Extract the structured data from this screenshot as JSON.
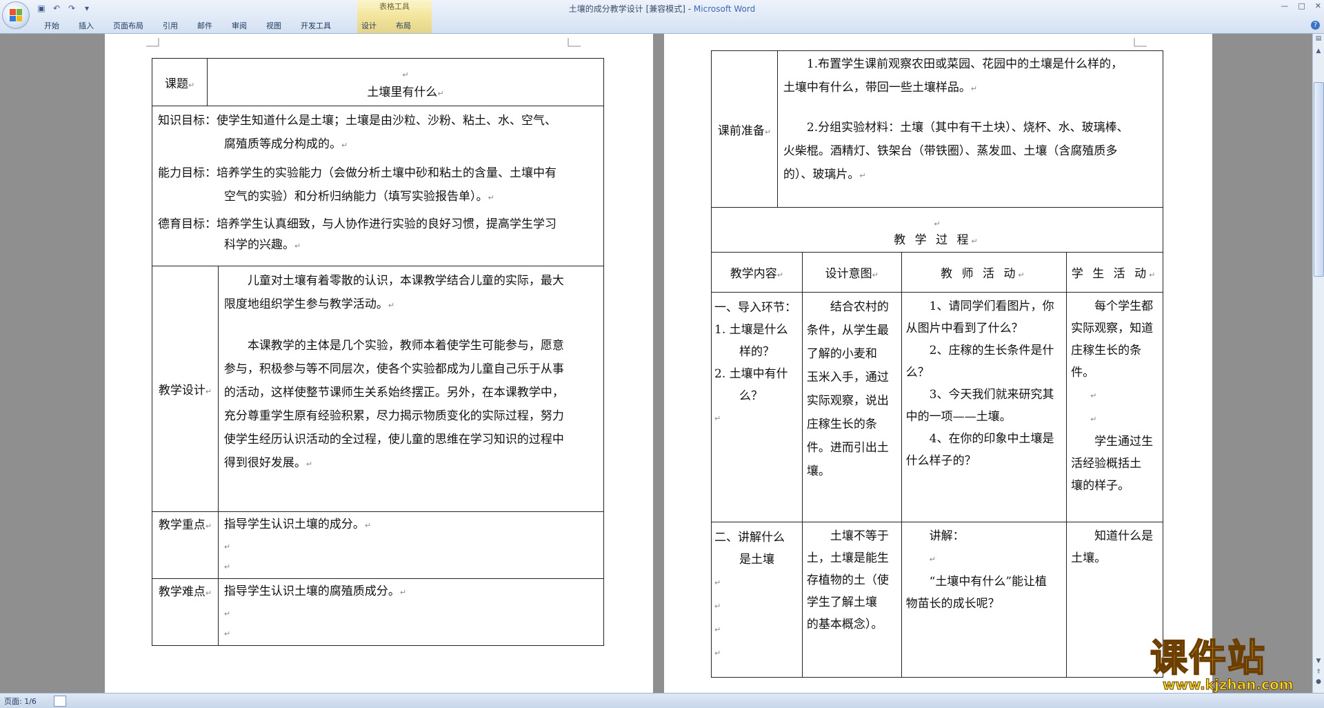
{
  "window": {
    "doc_title": "土壤的成分教学设计 [兼容模式] - ",
    "app_name": "Microsoft Word",
    "context_tools_label": "表格工具"
  },
  "ribbon": {
    "tabs": [
      "开始",
      "插入",
      "页面布局",
      "引用",
      "邮件",
      "审阅",
      "视图",
      "开发工具",
      "设计",
      "布局"
    ]
  },
  "status_bar": {
    "page": "页面: 1/6"
  },
  "page1": {
    "topic_label": "课题",
    "topic_value": "土壤里有什么",
    "objectives": [
      {
        "label": "知识目标：",
        "text": "使学生知道什么是土壤；土壤是由沙粒、沙粉、粘土、水、空气、",
        "cont": "腐殖质等成分构成的。"
      },
      {
        "label": "能力目标：",
        "text": "培养学生的实验能力（会做分析土壤中砂和粘土的含量、土壤中有",
        "cont": "空气的实验）和分析归纳能力（填写实验报告单）。"
      },
      {
        "label": "德育目标：",
        "text": "培养学生认真细致，与人协作进行实验的良好习惯，提高学生学习",
        "cont": "科学的兴趣。"
      }
    ],
    "design_label": "教学设计",
    "design_p1_l1": "儿童对土壤有着零散的认识，本课教学结合儿童的实际，最大",
    "design_p1_l2": "限度地组织学生参与教学活动。",
    "design_p2_lines": [
      "本课教学的主体是几个实验，教师本着使学生可能参与，愿意",
      "参与，积极参与等不同层次，使各个实验都成为儿童自己乐于从事",
      "的活动，这样使整节课师生关系始终摆正。另外，在本课教学中，",
      "充分尊重学生原有经验积累，尽力揭示物质变化的实际过程，努力",
      "使学生经历认识活动的全过程，使儿童的思维在学习知识的过程中",
      "得到很好发展。"
    ],
    "key_label": "教学重点",
    "key_text": "指导学生认识土壤的成分。",
    "difficulty_label": "教学难点",
    "difficulty_text": "指导学生认识土壤的腐殖质成分。"
  },
  "page2": {
    "prep_label": "课前准备",
    "prep_lines": [
      "1.布置学生课前观察农田或菜园、花园中的土壤是什么样的，",
      "土壤中有什么，带回一些土壤样品。",
      "2.分组实验材料：土壤（其中有干土块）、烧杯、水、玻璃棒、",
      "火柴棍。酒精灯、铁架台（带铁圈）、蒸发皿、土壤（含腐殖质多",
      "的）、玻璃片。"
    ],
    "process_title": "教 学 过 程",
    "headers": [
      "教学内容",
      "设计意图",
      "教 师 活 动",
      "学 生 活 动"
    ],
    "rows": [
      {
        "content": [
          "一、导入环节：",
          "1. 土壤是什么",
          "样的？",
          "2. 土壤中有什",
          "么？"
        ],
        "intent": [
          "结合农村的",
          "条件，从学生最",
          "了解的小麦和",
          "玉米入手，通过",
          "实际观察，说出",
          "庄稼生长的条",
          "件。进而引出土",
          "壤。"
        ],
        "teacher": [
          "1、请同学们看图片，你",
          "从图片中看到了什么？",
          "2、庄稼的生长条件是什",
          "么？",
          "3、今天我们就来研究其",
          "中的一项——土壤。",
          "4、在你的印象中土壤是",
          "什么样子的？"
        ],
        "student": [
          "每个学生都",
          "实际观察，知道",
          "庄稼生长的条",
          "件。",
          "",
          "",
          "学生通过生",
          "活经验概括土",
          "壤的样子。"
        ]
      },
      {
        "content": [
          "二、讲解什么",
          "是土壤"
        ],
        "intent": [
          "土壤不等于",
          "土，土壤是能生",
          "存植物的土（使",
          "学生了解土壤",
          "的基本概念）。"
        ],
        "teacher": [
          "讲解：",
          "",
          "“土壤中有什么”能让植",
          "物苗长的成长呢？"
        ],
        "student": [
          "知道什么是",
          "土壤。"
        ]
      }
    ]
  },
  "watermark": {
    "cn": "课件站",
    "url": "www.kjzhan.com"
  }
}
